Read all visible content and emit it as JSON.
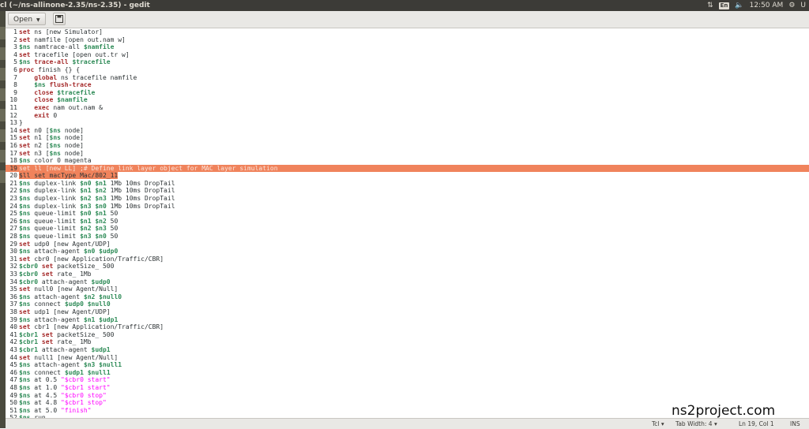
{
  "window": {
    "title": "cl (~/ns-allinone-2.35/ns-2.35) - gedit",
    "language_indicator": "En",
    "time": "12:50 AM",
    "user_short": "U"
  },
  "toolbar": {
    "open_label": "Open"
  },
  "editor": {
    "highlight_color": "#f0835c",
    "lines": [
      {
        "n": "1",
        "t": [
          [
            "kw",
            "set"
          ],
          [
            "",
            ""
          ],
          [
            "",
            " ns [new Simulator]"
          ]
        ]
      },
      {
        "n": "2",
        "t": [
          [
            "kw",
            "set"
          ],
          [
            "",
            " namfile [open out.nam w]"
          ]
        ]
      },
      {
        "n": "3",
        "t": [
          [
            "var",
            "$ns"
          ],
          [
            "",
            " namtrace-all "
          ],
          [
            "var",
            "$namfile"
          ]
        ]
      },
      {
        "n": "4",
        "t": [
          [
            "kw",
            "set"
          ],
          [
            "",
            " tracefile [open out.tr w]"
          ]
        ]
      },
      {
        "n": "5",
        "t": [
          [
            "var",
            "$ns"
          ],
          [
            "kw",
            " trace-all "
          ],
          [
            "var",
            "$tracefile"
          ]
        ]
      },
      {
        "n": "6",
        "t": [
          [
            "kw",
            "proc"
          ],
          [
            "",
            " finish {} {"
          ]
        ]
      },
      {
        "n": "7",
        "t": [
          [
            "",
            "    "
          ],
          [
            "kw",
            "global"
          ],
          [
            "",
            " ns tracefile namfile"
          ]
        ]
      },
      {
        "n": "8",
        "t": [
          [
            "",
            "    "
          ],
          [
            "var",
            "$ns"
          ],
          [
            "kw",
            " flush-trace"
          ]
        ]
      },
      {
        "n": "9",
        "t": [
          [
            "",
            "    "
          ],
          [
            "kw",
            "close"
          ],
          [
            "",
            " "
          ],
          [
            "var",
            "$tracefile"
          ]
        ]
      },
      {
        "n": "10",
        "t": [
          [
            "",
            "    "
          ],
          [
            "kw",
            "close"
          ],
          [
            "",
            " "
          ],
          [
            "var",
            "$namfile"
          ]
        ]
      },
      {
        "n": "11",
        "t": [
          [
            "",
            "    "
          ],
          [
            "kw",
            "exec"
          ],
          [
            "",
            " nam out.nam &"
          ]
        ]
      },
      {
        "n": "12",
        "t": [
          [
            "",
            "    "
          ],
          [
            "kw",
            "exit"
          ],
          [
            "",
            " 0"
          ]
        ]
      },
      {
        "n": "13",
        "t": [
          [
            "",
            "}"
          ]
        ]
      },
      {
        "n": "14",
        "t": [
          [
            "kw",
            "set"
          ],
          [
            "",
            " n0 ["
          ],
          [
            "var",
            "$ns"
          ],
          [
            "",
            " node]"
          ]
        ]
      },
      {
        "n": "15",
        "t": [
          [
            "kw",
            "set"
          ],
          [
            "",
            " n1 ["
          ],
          [
            "var",
            "$ns"
          ],
          [
            "",
            " node]"
          ]
        ]
      },
      {
        "n": "16",
        "t": [
          [
            "kw",
            "set"
          ],
          [
            "",
            " n2 ["
          ],
          [
            "var",
            "$ns"
          ],
          [
            "",
            " node]"
          ]
        ]
      },
      {
        "n": "17",
        "t": [
          [
            "kw",
            "set"
          ],
          [
            "",
            " n3 ["
          ],
          [
            "var",
            "$ns"
          ],
          [
            "",
            " node]"
          ]
        ]
      },
      {
        "n": "18",
        "t": [
          [
            "var",
            "$ns"
          ],
          [
            "",
            " color 0 magenta"
          ]
        ]
      },
      {
        "n": "19",
        "hl": true,
        "t": [
          [
            "",
            "set ll [new LL] ;# Define link layer object for MAC layer simulation"
          ]
        ]
      },
      {
        "n": "20",
        "sel": true,
        "t": [
          [
            "",
            "$ll set macType Mac/802_11"
          ]
        ]
      },
      {
        "n": "21",
        "t": [
          [
            "var",
            "$ns"
          ],
          [
            "",
            " duplex-link "
          ],
          [
            "var",
            "$n0"
          ],
          [
            "",
            " "
          ],
          [
            "var",
            "$n1"
          ],
          [
            "",
            " 1Mb 10ms DropTail"
          ]
        ]
      },
      {
        "n": "22",
        "t": [
          [
            "var",
            "$ns"
          ],
          [
            "",
            " duplex-link "
          ],
          [
            "var",
            "$n1"
          ],
          [
            "",
            " "
          ],
          [
            "var",
            "$n2"
          ],
          [
            "",
            " 1Mb 10ms DropTail"
          ]
        ]
      },
      {
        "n": "23",
        "t": [
          [
            "var",
            "$ns"
          ],
          [
            "",
            " duplex-link "
          ],
          [
            "var",
            "$n2"
          ],
          [
            "",
            " "
          ],
          [
            "var",
            "$n3"
          ],
          [
            "",
            " 1Mb 10ms DropTail"
          ]
        ]
      },
      {
        "n": "24",
        "t": [
          [
            "var",
            "$ns"
          ],
          [
            "",
            " duplex-link "
          ],
          [
            "var",
            "$n3"
          ],
          [
            "",
            " "
          ],
          [
            "var",
            "$n0"
          ],
          [
            "",
            " 1Mb 10ms DropTail"
          ]
        ]
      },
      {
        "n": "25",
        "t": [
          [
            "var",
            "$ns"
          ],
          [
            "",
            " queue-limit "
          ],
          [
            "var",
            "$n0"
          ],
          [
            "",
            " "
          ],
          [
            "var",
            "$n1"
          ],
          [
            "",
            " 50"
          ]
        ]
      },
      {
        "n": "26",
        "t": [
          [
            "var",
            "$ns"
          ],
          [
            "",
            " queue-limit "
          ],
          [
            "var",
            "$n1"
          ],
          [
            "",
            " "
          ],
          [
            "var",
            "$n2"
          ],
          [
            "",
            " 50"
          ]
        ]
      },
      {
        "n": "27",
        "t": [
          [
            "var",
            "$ns"
          ],
          [
            "",
            " queue-limit "
          ],
          [
            "var",
            "$n2"
          ],
          [
            "",
            " "
          ],
          [
            "var",
            "$n3"
          ],
          [
            "",
            " 50"
          ]
        ]
      },
      {
        "n": "28",
        "t": [
          [
            "var",
            "$ns"
          ],
          [
            "",
            " queue-limit "
          ],
          [
            "var",
            "$n3"
          ],
          [
            "",
            " "
          ],
          [
            "var",
            "$n0"
          ],
          [
            "",
            " 50"
          ]
        ]
      },
      {
        "n": "29",
        "t": [
          [
            "kw",
            "set"
          ],
          [
            "",
            " udp0 [new Agent/UDP]"
          ]
        ]
      },
      {
        "n": "30",
        "t": [
          [
            "var",
            "$ns"
          ],
          [
            "",
            " attach-agent "
          ],
          [
            "var",
            "$n0"
          ],
          [
            "",
            " "
          ],
          [
            "var",
            "$udp0"
          ]
        ]
      },
      {
        "n": "31",
        "t": [
          [
            "kw",
            "set"
          ],
          [
            "",
            " cbr0 [new Application/Traffic/CBR]"
          ]
        ]
      },
      {
        "n": "32",
        "t": [
          [
            "var",
            "$cbr0"
          ],
          [
            "kw",
            " set"
          ],
          [
            "",
            " packetSize_ 500"
          ]
        ]
      },
      {
        "n": "33",
        "t": [
          [
            "var",
            "$cbr0"
          ],
          [
            "kw",
            " set"
          ],
          [
            "",
            " rate_ 1Mb"
          ]
        ]
      },
      {
        "n": "34",
        "t": [
          [
            "var",
            "$cbr0"
          ],
          [
            "",
            " attach-agent "
          ],
          [
            "var",
            "$udp0"
          ]
        ]
      },
      {
        "n": "35",
        "t": [
          [
            "kw",
            "set"
          ],
          [
            "",
            " null0 [new Agent/Null]"
          ]
        ]
      },
      {
        "n": "36",
        "t": [
          [
            "var",
            "$ns"
          ],
          [
            "",
            " attach-agent "
          ],
          [
            "var",
            "$n2"
          ],
          [
            "",
            " "
          ],
          [
            "var",
            "$null0"
          ]
        ]
      },
      {
        "n": "37",
        "t": [
          [
            "var",
            "$ns"
          ],
          [
            "",
            " connect "
          ],
          [
            "var",
            "$udp0"
          ],
          [
            "",
            " "
          ],
          [
            "var",
            "$null0"
          ]
        ]
      },
      {
        "n": "38",
        "t": [
          [
            "kw",
            "set"
          ],
          [
            "",
            " udp1 [new Agent/UDP]"
          ]
        ]
      },
      {
        "n": "39",
        "t": [
          [
            "var",
            "$ns"
          ],
          [
            "",
            " attach-agent "
          ],
          [
            "var",
            "$n1"
          ],
          [
            "",
            " "
          ],
          [
            "var",
            "$udp1"
          ]
        ]
      },
      {
        "n": "40",
        "t": [
          [
            "kw",
            "set"
          ],
          [
            "",
            " cbr1 [new Application/Traffic/CBR]"
          ]
        ]
      },
      {
        "n": "41",
        "t": [
          [
            "var",
            "$cbr1"
          ],
          [
            "kw",
            " set"
          ],
          [
            "",
            " packetSize_ 500"
          ]
        ]
      },
      {
        "n": "42",
        "t": [
          [
            "var",
            "$cbr1"
          ],
          [
            "kw",
            " set"
          ],
          [
            "",
            " rate_ 1Mb"
          ]
        ]
      },
      {
        "n": "43",
        "t": [
          [
            "var",
            "$cbr1"
          ],
          [
            "",
            " attach-agent "
          ],
          [
            "var",
            "$udp1"
          ]
        ]
      },
      {
        "n": "44",
        "t": [
          [
            "kw",
            "set"
          ],
          [
            "",
            " null1 [new Agent/Null]"
          ]
        ]
      },
      {
        "n": "45",
        "t": [
          [
            "var",
            "$ns"
          ],
          [
            "",
            " attach-agent "
          ],
          [
            "var",
            "$n3"
          ],
          [
            "",
            " "
          ],
          [
            "var",
            "$null1"
          ]
        ]
      },
      {
        "n": "46",
        "t": [
          [
            "var",
            "$ns"
          ],
          [
            "",
            " connect "
          ],
          [
            "var",
            "$udp1"
          ],
          [
            "",
            " "
          ],
          [
            "var",
            "$null1"
          ]
        ]
      },
      {
        "n": "47",
        "t": [
          [
            "var",
            "$ns"
          ],
          [
            "",
            " at 0.5 "
          ],
          [
            "str",
            "\"$cbr0 start\""
          ]
        ]
      },
      {
        "n": "48",
        "t": [
          [
            "var",
            "$ns"
          ],
          [
            "",
            " at 1.0 "
          ],
          [
            "str",
            "\"$cbr1 start\""
          ]
        ]
      },
      {
        "n": "49",
        "t": [
          [
            "var",
            "$ns"
          ],
          [
            "",
            " at 4.5 "
          ],
          [
            "str",
            "\"$cbr0 stop\""
          ]
        ]
      },
      {
        "n": "50",
        "t": [
          [
            "var",
            "$ns"
          ],
          [
            "",
            " at 4.8 "
          ],
          [
            "str",
            "\"$cbr1 stop\""
          ]
        ]
      },
      {
        "n": "51",
        "t": [
          [
            "var",
            "$ns"
          ],
          [
            "",
            " at 5.0 "
          ],
          [
            "str",
            "\"finish\""
          ]
        ]
      },
      {
        "n": "52",
        "t": [
          [
            "var",
            "$ns"
          ],
          [
            "",
            " run"
          ]
        ]
      }
    ]
  },
  "statusbar": {
    "language": "Tcl",
    "tab_width": "Tab Width: 4",
    "position": "Ln 19, Col 1",
    "mode": "INS"
  },
  "watermark": "ns2project.com"
}
